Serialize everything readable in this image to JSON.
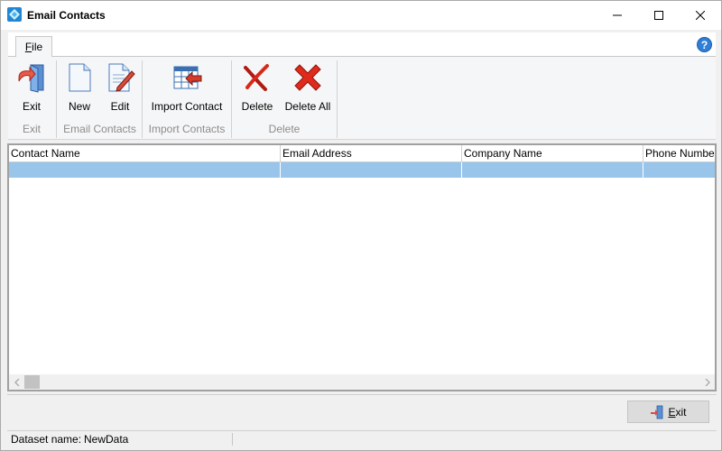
{
  "window": {
    "title": "Email Contacts",
    "app_icon": "app-logo-icon",
    "controls": [
      "minimize-icon",
      "maximize-icon",
      "close-icon"
    ]
  },
  "ribbon": {
    "tabs": [
      {
        "label_ul": "F",
        "label_rest": "ile"
      }
    ],
    "help_icon": "help-icon",
    "groups": [
      {
        "label": "Exit",
        "buttons": [
          {
            "label": "Exit",
            "icon": "exit-door-icon"
          }
        ]
      },
      {
        "label": "Email Contacts",
        "buttons": [
          {
            "label": "New",
            "icon": "new-document-icon"
          },
          {
            "label": "Edit",
            "icon": "edit-document-icon"
          }
        ]
      },
      {
        "label": "Import Contacts",
        "buttons": [
          {
            "label": "Import Contact",
            "icon": "import-table-icon"
          }
        ]
      },
      {
        "label": "Delete",
        "buttons": [
          {
            "label": "Delete",
            "icon": "delete-icon"
          },
          {
            "label": "Delete All",
            "icon": "delete-all-icon"
          }
        ]
      }
    ]
  },
  "grid": {
    "columns": [
      "Contact Name",
      "Email Address",
      "Company Name",
      "Phone Number"
    ],
    "rows": [
      [
        "",
        "",
        "",
        ""
      ]
    ],
    "selection_color": "#99c5eb"
  },
  "footer": {
    "exit_button": {
      "label_ul": "E",
      "label_rest": "xit",
      "icon": "exit-door-icon"
    }
  },
  "status": {
    "label": "Dataset name:",
    "value": "NewData"
  }
}
